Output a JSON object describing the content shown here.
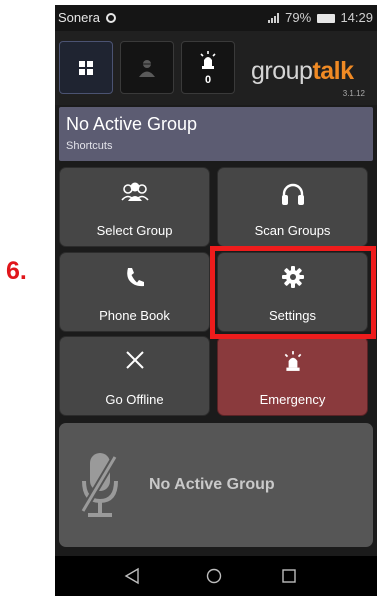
{
  "step_label": "6.",
  "status_bar": {
    "carrier": "Sonera",
    "battery": "79%",
    "time": "14:29"
  },
  "app_bar": {
    "alarm_count": "0",
    "logo_part1": "group",
    "logo_part2": "talk",
    "version": "3.1.12"
  },
  "group": {
    "title": "No Active Group",
    "subtitle": "Shortcuts"
  },
  "tiles": {
    "select_group": "Select Group",
    "scan_groups": "Scan Groups",
    "phone_book": "Phone Book",
    "settings": "Settings",
    "go_offline": "Go Offline",
    "emergency": "Emergency"
  },
  "ptt": {
    "label": "No Active Group"
  },
  "colors": {
    "highlight": "#ee1c1c",
    "group_header": "#5c5c72",
    "emergency": "#8a3a3d",
    "logo_accent": "#f08a24"
  },
  "icons": {
    "grid": "grid-icon",
    "agent": "agent-icon",
    "alarm": "alarm-icon",
    "select_group": "group-icon",
    "scan_groups": "headphones-icon",
    "phone_book": "phone-icon",
    "settings": "gear-icon",
    "go_offline": "close-icon",
    "emergency": "alarm-icon",
    "ptt": "mic-off-icon"
  }
}
